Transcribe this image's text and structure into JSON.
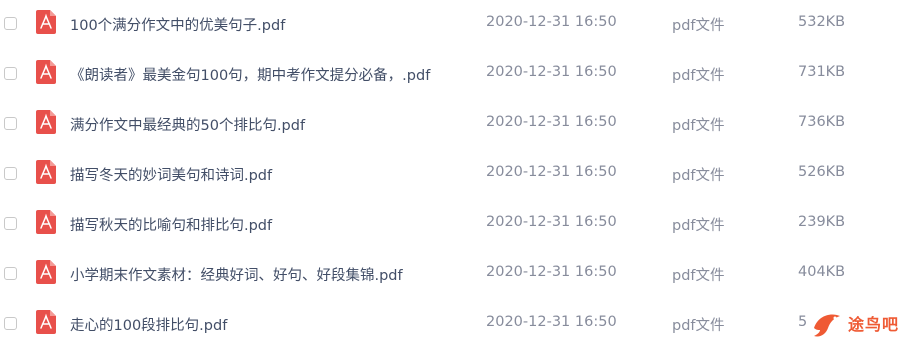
{
  "files": [
    {
      "name": "100个满分作文中的优美句子.pdf",
      "date": "2020-12-31 16:50",
      "type": "pdf文件",
      "size": "532KB",
      "icon": "pdf-file-icon"
    },
    {
      "name": "《朗读者》最美金句100句，期中考作文提分必备，.pdf",
      "date": "2020-12-31 16:50",
      "type": "pdf文件",
      "size": "731KB",
      "icon": "pdf-file-icon"
    },
    {
      "name": "满分作文中最经典的50个排比句.pdf",
      "date": "2020-12-31 16:50",
      "type": "pdf文件",
      "size": "736KB",
      "icon": "pdf-file-icon"
    },
    {
      "name": "描写冬天的妙词美句和诗词.pdf",
      "date": "2020-12-31 16:50",
      "type": "pdf文件",
      "size": "526KB",
      "icon": "pdf-file-icon"
    },
    {
      "name": "描写秋天的比喻句和排比句.pdf",
      "date": "2020-12-31 16:50",
      "type": "pdf文件",
      "size": "239KB",
      "icon": "pdf-file-icon"
    },
    {
      "name": "小学期末作文素材：经典好词、好句、好段集锦.pdf",
      "date": "2020-12-31 16:50",
      "type": "pdf文件",
      "size": "404KB",
      "icon": "pdf-file-icon"
    },
    {
      "name": "走心的100段排比句.pdf",
      "date": "2020-12-31 16:50",
      "type": "pdf文件",
      "size": "5",
      "icon": "pdf-file-icon"
    }
  ],
  "watermark": {
    "text": "途鸟吧",
    "logo": "bird-logo"
  },
  "colors": {
    "pdf_icon": "#e8504b",
    "name_text": "#424e67",
    "meta_text": "#878c9c",
    "watermark": "#ef5a34"
  }
}
